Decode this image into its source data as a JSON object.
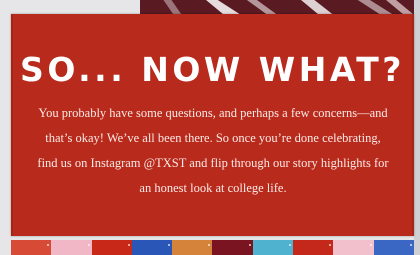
{
  "card": {
    "headline": "SO... NOW WHAT?",
    "body": "You probably have some questions, and perhaps a few concerns—and that’s okay! We’ve all been there. So once you’re done celebrating, find us on Instagram @TXST and flip through our story highlights for an honest look at college life."
  },
  "colors": {
    "card_background": "#b82a1c",
    "text": "#ffffff",
    "decor_top": "#5a1a22",
    "stripe": [
      "#d64a36",
      "#f2b7c6",
      "#c72818",
      "#2a56b8",
      "#d5823a",
      "#7a1420",
      "#4fb3d0",
      "#c3281a",
      "#f2c0cc",
      "#3a66c4"
    ]
  }
}
